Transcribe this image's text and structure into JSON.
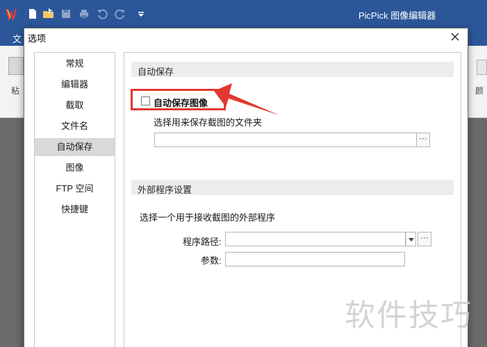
{
  "app": {
    "title": "PicPick 图像编辑器",
    "file_tab_label": "文",
    "paste_label": "粘",
    "color_label": "颜"
  },
  "dialog": {
    "title": "选项",
    "nav_items": [
      {
        "label": "常规"
      },
      {
        "label": "编辑器"
      },
      {
        "label": "截取"
      },
      {
        "label": "文件名"
      },
      {
        "label": "自动保存",
        "selected": true
      },
      {
        "label": "图像"
      },
      {
        "label": "FTP 空间"
      },
      {
        "label": "快捷键"
      }
    ],
    "autosave": {
      "section_title": "自动保存",
      "checkbox_label": "自动保存图像",
      "checkbox_checked": false,
      "folder_label": "选择用来保存截图的文件夹",
      "folder_value": "",
      "browse_label": "···"
    },
    "external": {
      "section_title": "外部程序设置",
      "description": "选择一个用于接收截图的外部程序",
      "path_label": "程序路径:",
      "path_value": "",
      "browse_label": "···",
      "params_label": "参数:",
      "params_value": ""
    }
  },
  "annotation": {
    "color": "#e2382f"
  },
  "watermark": "软件技巧"
}
